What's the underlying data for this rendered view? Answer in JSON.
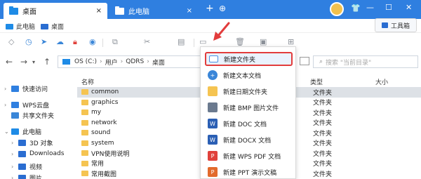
{
  "tabs": [
    {
      "label": "桌面",
      "close": "×"
    },
    {
      "label": "此电脑",
      "close": "×"
    }
  ],
  "titlebar": {
    "plus": "+",
    "new_window": "⊕",
    "min": "—",
    "max": "☐",
    "close": "✕"
  },
  "quick": [
    {
      "label": "此电脑"
    },
    {
      "label": "桌面"
    }
  ],
  "toolbox": {
    "label": "工具箱"
  },
  "address": {
    "crumbs": [
      "OS (C:)",
      "用户",
      "QDRS",
      "桌面"
    ],
    "sep": "›"
  },
  "search": {
    "placeholder": "搜索 \"当前目录\""
  },
  "columns": {
    "name": "名称",
    "type": "类型",
    "size": "大小"
  },
  "sidebar": [
    {
      "label": "快速访问",
      "icon": "star-icon",
      "color": "#2f7fe0"
    },
    {
      "label": "WPS云盘",
      "icon": "cloud-icon",
      "color": "#2f7fe0"
    },
    {
      "label": "共享文件夹",
      "icon": "share-folder-icon",
      "color": "#3a86d8"
    },
    {
      "label": "此电脑",
      "icon": "computer-icon",
      "color": "#1e8be6"
    },
    {
      "label": "3D 对象",
      "icon": "3d-icon",
      "color": "#2a6dd1"
    },
    {
      "label": "Downloads",
      "icon": "download-icon",
      "color": "#2a6dd1"
    },
    {
      "label": "视频",
      "icon": "video-icon",
      "color": "#2a6dd1"
    },
    {
      "label": "图片",
      "icon": "picture-icon",
      "color": "#2a6dd1"
    }
  ],
  "files": [
    {
      "name": "common",
      "type": "文件夹"
    },
    {
      "name": "graphics",
      "type": "文件夹"
    },
    {
      "name": "my",
      "type": "文件夹"
    },
    {
      "name": "network",
      "type": "文件夹"
    },
    {
      "name": "sound",
      "type": "文件夹"
    },
    {
      "name": "system",
      "type": "文件夹"
    },
    {
      "name": "VPN使用说明",
      "type": "文件夹"
    },
    {
      "name": "常用",
      "type": "文件夹"
    },
    {
      "name": "常用截图",
      "type": "文件夹"
    }
  ],
  "menu": [
    {
      "label": "新建文件夹",
      "icon": "folder-icon",
      "color": "#4a90e2"
    },
    {
      "label": "新建文本文档",
      "icon": "text-doc-icon",
      "color": "#3a86d8"
    },
    {
      "label": "新建日期文件夹",
      "icon": "date-folder-icon",
      "color": "#f5c451"
    },
    {
      "label": "新建 BMP 图片文件",
      "icon": "bmp-icon",
      "color": "#6b7a8f"
    },
    {
      "label": "新建 DOC 文档",
      "icon": "doc-icon",
      "color": "#2b5fb4"
    },
    {
      "label": "新建 DOCX 文档",
      "icon": "docx-icon",
      "color": "#2b5fb4"
    },
    {
      "label": "新建 WPS PDF 文档",
      "icon": "pdf-icon",
      "color": "#e0413b"
    },
    {
      "label": "新建 PPT 演示文稿",
      "icon": "ppt-icon",
      "color": "#e26a2c"
    }
  ]
}
